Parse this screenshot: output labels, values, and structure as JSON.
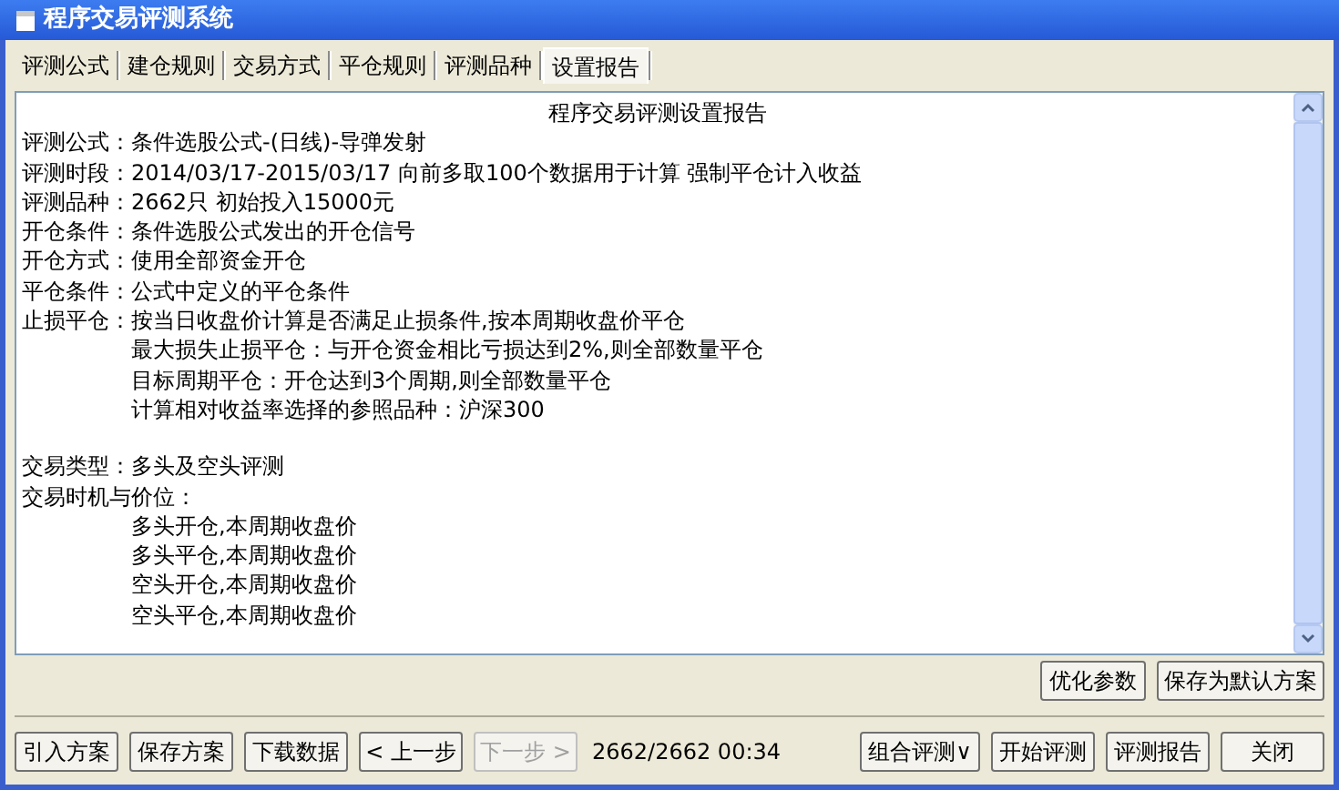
{
  "window": {
    "title": "程序交易评测系统"
  },
  "tabs": [
    {
      "label": "评测公式",
      "selected": false
    },
    {
      "label": "建仓规则",
      "selected": false
    },
    {
      "label": "交易方式",
      "selected": false
    },
    {
      "label": "平仓规则",
      "selected": false
    },
    {
      "label": "评测品种",
      "selected": false
    },
    {
      "label": "设置报告",
      "selected": true
    }
  ],
  "report": [
    {
      "kind": "title",
      "text": "程序交易评测设置报告"
    },
    {
      "kind": "line",
      "text": "评测公式：条件选股公式-(日线)-导弹发射"
    },
    {
      "kind": "line",
      "text": "评测时段：2014/03/17-2015/03/17 向前多取100个数据用于计算 强制平仓计入收益"
    },
    {
      "kind": "line",
      "text": "评测品种：2662只 初始投入15000元"
    },
    {
      "kind": "line",
      "text": "开仓条件：条件选股公式发出的开仓信号"
    },
    {
      "kind": "line",
      "text": "开仓方式：使用全部资金开仓"
    },
    {
      "kind": "line",
      "text": "平仓条件：公式中定义的平仓条件"
    },
    {
      "kind": "line",
      "text": "止损平仓：按当日收盘价计算是否满足止损条件,按本周期收盘价平仓"
    },
    {
      "kind": "indent",
      "text": "最大损失止损平仓：与开仓资金相比亏损达到2%,则全部数量平仓"
    },
    {
      "kind": "indent",
      "text": "目标周期平仓：开仓达到3个周期,则全部数量平仓"
    },
    {
      "kind": "indent",
      "text": "计算相对收益率选择的参照品种：沪深300"
    },
    {
      "kind": "gap"
    },
    {
      "kind": "line",
      "text": "交易类型：多头及空头评测"
    },
    {
      "kind": "line",
      "text": "交易时机与价位："
    },
    {
      "kind": "indent",
      "text": "多头开仓,本周期收盘价"
    },
    {
      "kind": "indent",
      "text": "多头平仓,本周期收盘价"
    },
    {
      "kind": "indent",
      "text": "空头开仓,本周期收盘价"
    },
    {
      "kind": "indent",
      "text": "空头平仓,本周期收盘价"
    }
  ],
  "report_buttons": [
    "优化参数",
    "保存为默认方案"
  ],
  "left_buttons": [
    {
      "label": "引入方案",
      "disabled": false
    },
    {
      "label": "保存方案",
      "disabled": false
    },
    {
      "label": "下载数据",
      "disabled": false
    },
    {
      "label": "< 上一步",
      "disabled": false
    },
    {
      "label": "下一步 >",
      "disabled": true
    }
  ],
  "status": "2662/2662 00:34",
  "right_buttons": [
    {
      "label": "组合评测∨",
      "disabled": false
    },
    {
      "label": "开始评测",
      "disabled": false
    },
    {
      "label": "评测报告",
      "disabled": false
    },
    {
      "label": "关闭",
      "disabled": false
    }
  ]
}
